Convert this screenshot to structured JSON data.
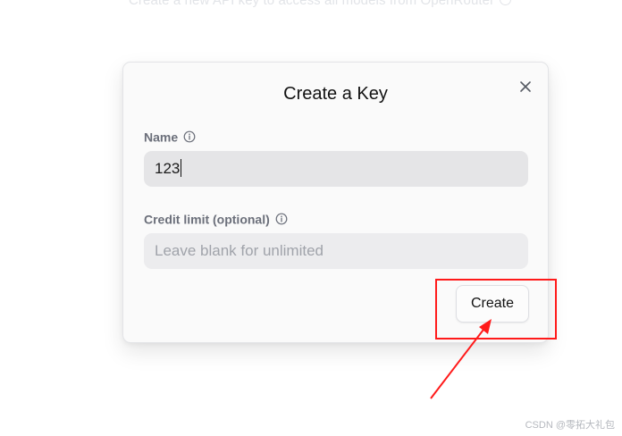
{
  "background": {
    "subtitle": "Create a new API key to access all models from OpenRouter"
  },
  "modal": {
    "title": "Create a Key",
    "close_icon": "close-icon",
    "name_field": {
      "label": "Name",
      "info_icon": "info-icon",
      "value": "123"
    },
    "credit_field": {
      "label": "Credit limit (optional)",
      "info_icon": "info-icon",
      "value": "",
      "placeholder": "Leave blank for unlimited"
    },
    "create_button": "Create"
  },
  "annotation": {
    "color": "#ff1a1a",
    "shapes": [
      "highlight-box",
      "arrow"
    ]
  },
  "watermark": "CSDN @零拓大礼包",
  "colors": {
    "title": "#111111",
    "label": "#6b6f7a",
    "input_bg": "#e5e5e7",
    "annotation": "#ff1a1a"
  }
}
